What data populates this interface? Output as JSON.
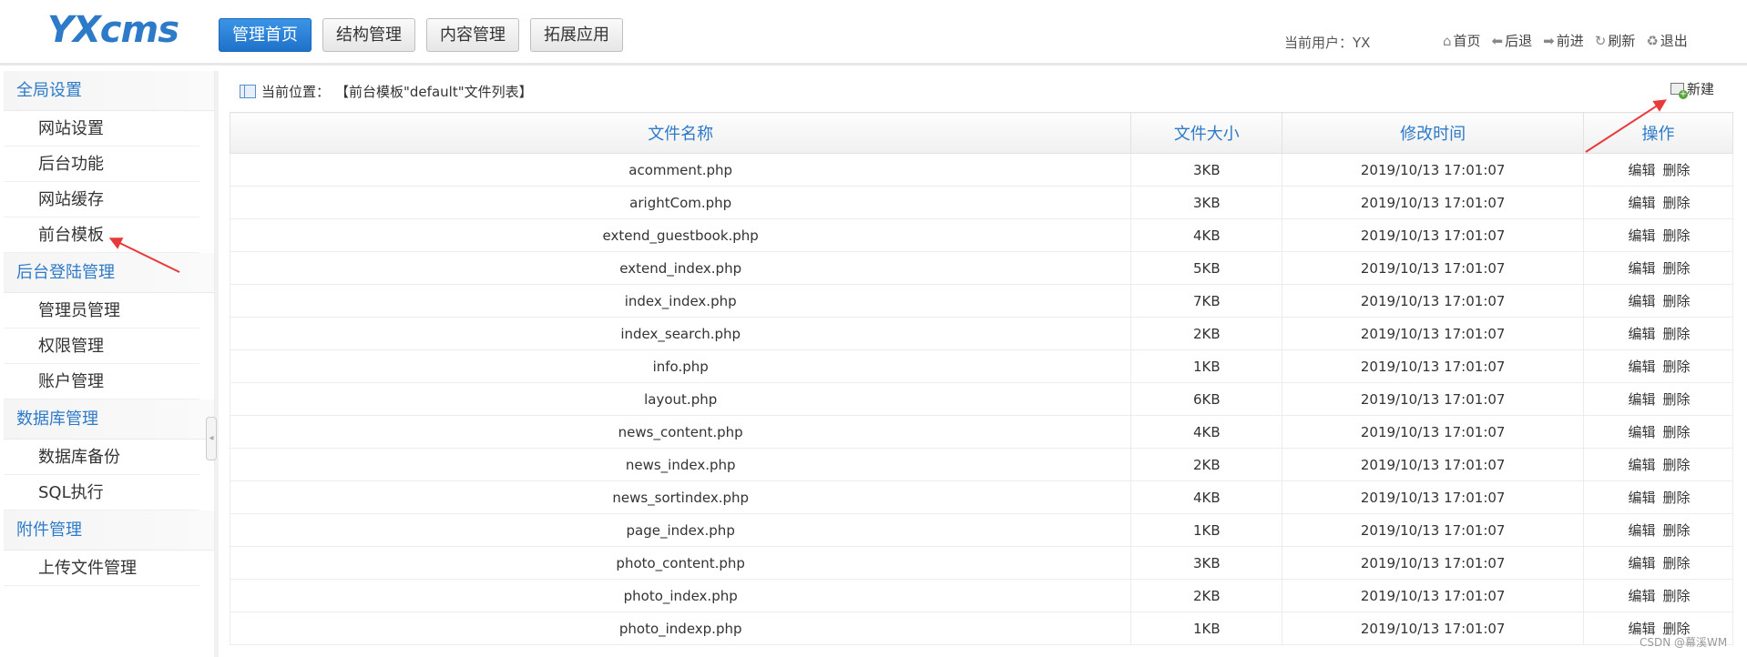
{
  "header": {
    "logo": "YXcms",
    "nav": [
      {
        "label": "管理首页",
        "active": true
      },
      {
        "label": "结构管理",
        "active": false
      },
      {
        "label": "内容管理",
        "active": false
      },
      {
        "label": "拓展应用",
        "active": false
      }
    ],
    "user_text": "当前用户：YX",
    "links": [
      {
        "label": "首页",
        "icon": "home-icon",
        "glyph": "⌂"
      },
      {
        "label": "后退",
        "icon": "back-arrow-icon",
        "glyph": "⬅"
      },
      {
        "label": "前进",
        "icon": "forward-arrow-icon",
        "glyph": "➡"
      },
      {
        "label": "刷新",
        "icon": "refresh-icon",
        "glyph": "↻"
      },
      {
        "label": "退出",
        "icon": "logout-icon",
        "glyph": "♻"
      }
    ]
  },
  "sidebar": {
    "groups": [
      {
        "title": "全局设置",
        "items": [
          "网站设置",
          "后台功能",
          "网站缓存",
          "前台模板"
        ]
      },
      {
        "title": "后台登陆管理",
        "items": [
          "管理员管理",
          "权限管理",
          "账户管理"
        ]
      },
      {
        "title": "数据库管理",
        "items": [
          "数据库备份",
          "SQL执行"
        ]
      },
      {
        "title": "附件管理",
        "items": [
          "上传文件管理"
        ]
      }
    ]
  },
  "main": {
    "breadcrumb_label": "当前位置：",
    "breadcrumb_path": "【前台模板\"default\"文件列表】",
    "new_label": "新建",
    "columns": [
      "文件名称",
      "文件大小",
      "修改时间",
      "操作"
    ],
    "edit_label": "编辑",
    "delete_label": "删除",
    "rows": [
      {
        "name": "acomment.php",
        "size": "3KB",
        "time": "2019/10/13 17:01:07"
      },
      {
        "name": "arightCom.php",
        "size": "3KB",
        "time": "2019/10/13 17:01:07"
      },
      {
        "name": "extend_guestbook.php",
        "size": "4KB",
        "time": "2019/10/13 17:01:07"
      },
      {
        "name": "extend_index.php",
        "size": "5KB",
        "time": "2019/10/13 17:01:07"
      },
      {
        "name": "index_index.php",
        "size": "7KB",
        "time": "2019/10/13 17:01:07"
      },
      {
        "name": "index_search.php",
        "size": "2KB",
        "time": "2019/10/13 17:01:07"
      },
      {
        "name": "info.php",
        "size": "1KB",
        "time": "2019/10/13 17:01:07"
      },
      {
        "name": "layout.php",
        "size": "6KB",
        "time": "2019/10/13 17:01:07"
      },
      {
        "name": "news_content.php",
        "size": "4KB",
        "time": "2019/10/13 17:01:07"
      },
      {
        "name": "news_index.php",
        "size": "2KB",
        "time": "2019/10/13 17:01:07"
      },
      {
        "name": "news_sortindex.php",
        "size": "4KB",
        "time": "2019/10/13 17:01:07"
      },
      {
        "name": "page_index.php",
        "size": "1KB",
        "time": "2019/10/13 17:01:07"
      },
      {
        "name": "photo_content.php",
        "size": "3KB",
        "time": "2019/10/13 17:01:07"
      },
      {
        "name": "photo_index.php",
        "size": "2KB",
        "time": "2019/10/13 17:01:07"
      },
      {
        "name": "photo_indexp.php",
        "size": "1KB",
        "time": "2019/10/13 17:01:07"
      }
    ]
  },
  "watermark": "CSDN @幕溪WM",
  "colors": {
    "accent": "#2d7ac9",
    "filename": "#3a8a1f",
    "annotation": "#e83a3a"
  }
}
